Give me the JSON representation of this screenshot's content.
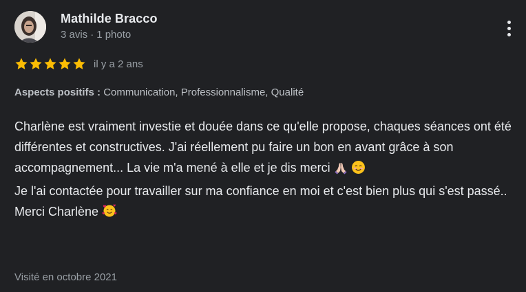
{
  "reviewer": {
    "name": "Mathilde Bracco",
    "review_count": "3 avis",
    "separator": "·",
    "photo_count": "1 photo",
    "avatar_icon": "user-photo-avatar"
  },
  "menu": {
    "icon": "more-vert-icon"
  },
  "rating": {
    "stars": 5,
    "max_stars": 5,
    "star_color": "#fbbc04",
    "time_ago": "il y a 2 ans"
  },
  "aspects": {
    "label": "Aspects positifs :",
    "values": "Communication, Professionnalisme, Qualité"
  },
  "review": {
    "line1": "Charlène est vraiment investie et douée dans ce qu'elle propose, chaques séances ont été différentes et constructives. J'ai réellement pu faire un bon en avant grâce à son accompagnement... La vie m'a mené à elle et je dis merci",
    "line1_emojis": [
      "praying-hands-emoji",
      "smiling-face-emoji"
    ],
    "line2": "Je l'ai contactée pour travailler sur ma confiance en moi et c'est bien plus qui s'est passé..",
    "line3": "Merci Charlène",
    "line3_emoji": "smiling-face-with-hearts-emoji"
  },
  "visited": "Visité en octobre 2021"
}
